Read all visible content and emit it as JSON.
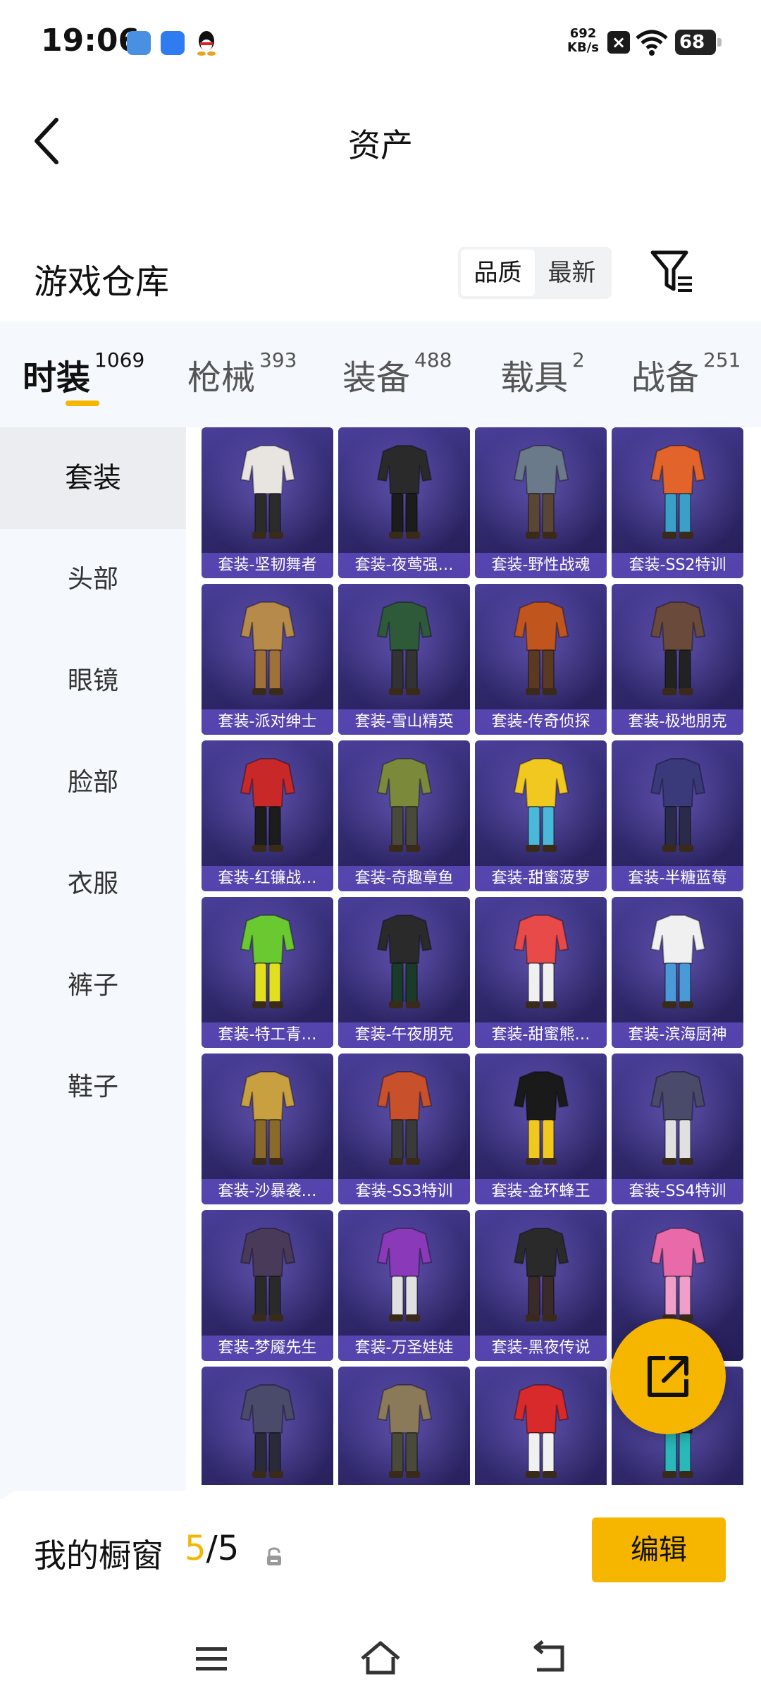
{
  "status_bar": {
    "time": "19:06",
    "net_speed_value": "692",
    "net_speed_unit": "KB/s",
    "battery": "68",
    "icons": [
      "app-notification-icon",
      "app-notification-icon",
      "qq-icon",
      "no-sim-icon",
      "wifi-icon",
      "battery-icon"
    ]
  },
  "header": {
    "title": "资产"
  },
  "warehouse": {
    "title": "游戏仓库",
    "sort_options": [
      "品质",
      "最新"
    ],
    "sort_selected": "品质"
  },
  "tabs": [
    {
      "label": "时装",
      "count": "1069",
      "active": true
    },
    {
      "label": "枪械",
      "count": "393",
      "active": false
    },
    {
      "label": "装备",
      "count": "488",
      "active": false
    },
    {
      "label": "载具",
      "count": "2",
      "active": false
    },
    {
      "label": "战备",
      "count": "251",
      "active": false
    }
  ],
  "sidebar": {
    "items": [
      {
        "label": "套装",
        "active": true
      },
      {
        "label": "头部",
        "active": false
      },
      {
        "label": "眼镜",
        "active": false
      },
      {
        "label": "脸部",
        "active": false
      },
      {
        "label": "衣服",
        "active": false
      },
      {
        "label": "裤子",
        "active": false
      },
      {
        "label": "鞋子",
        "active": false
      }
    ]
  },
  "items": [
    {
      "name": "套装-坚韧舞者",
      "palette": [
        "#e8e4e0",
        "#2b2b2b"
      ]
    },
    {
      "name": "套装-夜莺强…",
      "palette": [
        "#2a2a2a",
        "#1c1c1c"
      ]
    },
    {
      "name": "套装-野性战魂",
      "palette": [
        "#6b7a8a",
        "#5a4636"
      ]
    },
    {
      "name": "套装-SS2特训",
      "palette": [
        "#e2642a",
        "#3aa0c8"
      ]
    },
    {
      "name": "套装-派对绅士",
      "palette": [
        "#b58a4a",
        "#a0703a"
      ]
    },
    {
      "name": "套装-雪山精英",
      "palette": [
        "#2e5a3a",
        "#333333"
      ]
    },
    {
      "name": "套装-传奇侦探",
      "palette": [
        "#c0561e",
        "#5a3a22"
      ]
    },
    {
      "name": "套装-极地朋克",
      "palette": [
        "#6a4a3a",
        "#222222"
      ]
    },
    {
      "name": "套装-红镰战…",
      "palette": [
        "#c82828",
        "#1c1c1c"
      ]
    },
    {
      "name": "套装-奇趣章鱼",
      "palette": [
        "#7a8a3a",
        "#4a4a3a"
      ]
    },
    {
      "name": "套装-甜蜜菠萝",
      "palette": [
        "#f0c820",
        "#4ab8d8"
      ]
    },
    {
      "name": "套装-半糖蓝莓",
      "palette": [
        "#3a3a7a",
        "#2a2a4a"
      ]
    },
    {
      "name": "套装-特工青…",
      "palette": [
        "#6ac830",
        "#e0e020"
      ]
    },
    {
      "name": "套装-午夜朋克",
      "palette": [
        "#2a2a2a",
        "#1a3a2a"
      ]
    },
    {
      "name": "套装-甜蜜熊…",
      "palette": [
        "#e84a4a",
        "#f0f0f0"
      ]
    },
    {
      "name": "套装-滨海厨神",
      "palette": [
        "#f0f0f0",
        "#4a9ad8"
      ]
    },
    {
      "name": "套装-沙暴袭…",
      "palette": [
        "#c8a040",
        "#8a6a2a"
      ]
    },
    {
      "name": "套装-SS3特训",
      "palette": [
        "#c8502a",
        "#3a3a3a"
      ]
    },
    {
      "name": "套装-金环蜂王",
      "palette": [
        "#1a1a1a",
        "#f0c820"
      ]
    },
    {
      "name": "套装-SS4特训",
      "palette": [
        "#4a4a6a",
        "#e0e0e0"
      ]
    },
    {
      "name": "套装-梦魇先生",
      "palette": [
        "#4a3a5a",
        "#2a2a2a"
      ]
    },
    {
      "name": "套装-万圣娃娃",
      "palette": [
        "#8a3ab8",
        "#e0e0e0"
      ]
    },
    {
      "name": "套装-黑夜传说",
      "palette": [
        "#2a2a2a",
        "#3a2a2a"
      ]
    },
    {
      "name": "",
      "palette": [
        "#e86aa8",
        "#f0a0c8"
      ]
    },
    {
      "name": "",
      "palette": [
        "#4a4a6a",
        "#2a2a3a"
      ]
    },
    {
      "name": "",
      "palette": [
        "#8a7a5a",
        "#4a4a3a"
      ]
    },
    {
      "name": "",
      "palette": [
        "#d82a2a",
        "#f0f0f0"
      ]
    },
    {
      "name": "",
      "palette": [
        "#1a1a2a",
        "#2ab8b8"
      ]
    }
  ],
  "showcase": {
    "label": "我的橱窗",
    "used": "5",
    "separator": "/",
    "total": "5",
    "edit_label": "编辑"
  },
  "colors": {
    "accent": "#f6b600",
    "card_bg": "#2f286a",
    "panel_bg": "#f5f8fc"
  }
}
